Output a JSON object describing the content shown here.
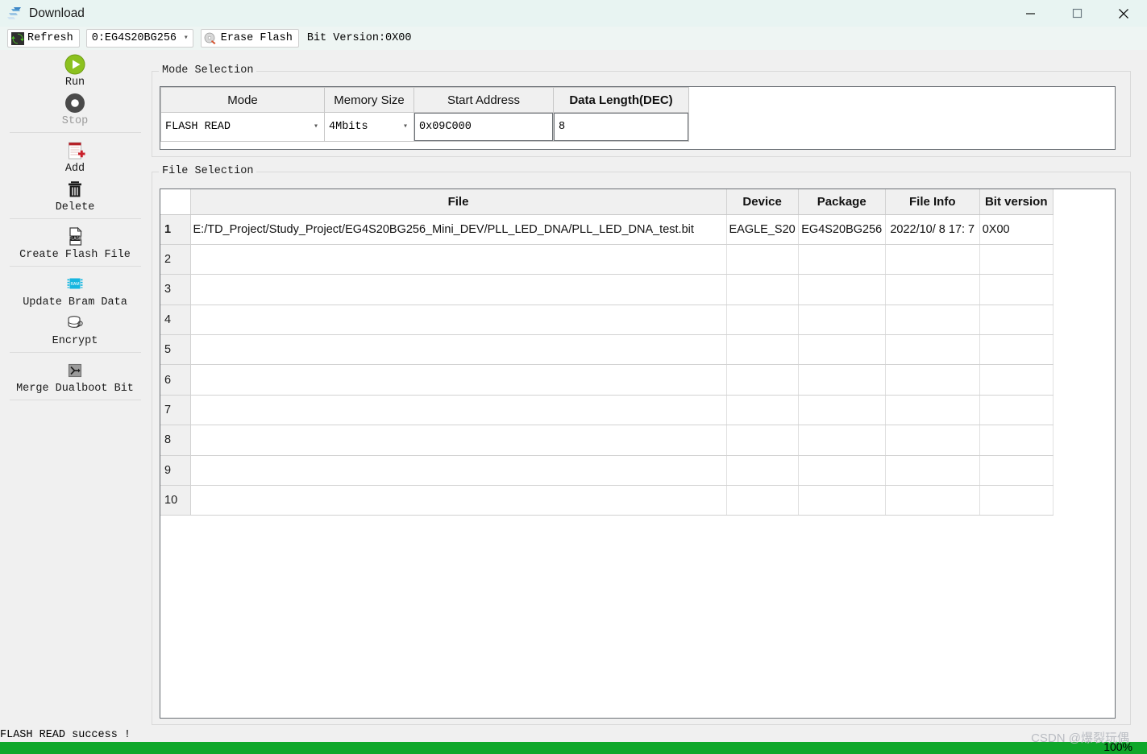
{
  "window": {
    "title": "Download",
    "icon": "app-logo-icon",
    "controls": {
      "minimize": "minimize-icon",
      "maximize": "maximize-icon",
      "close": "close-icon"
    }
  },
  "toolbar": {
    "refresh_label": "Refresh",
    "refresh_icon": "refresh-icon",
    "device_combo_value": "0:EG4S20BG256",
    "erase_label": "Erase Flash",
    "erase_icon": "disc-erase-icon",
    "bit_version_label": "Bit Version:0X00"
  },
  "sidebar": {
    "items": [
      {
        "label": "Run",
        "icon": "play-icon",
        "enabled": true
      },
      {
        "label": "Stop",
        "icon": "stop-icon",
        "enabled": false
      },
      {
        "label": "Add",
        "icon": "add-file-icon",
        "enabled": true
      },
      {
        "label": "Delete",
        "icon": "trash-icon",
        "enabled": true
      },
      {
        "label": "Create Flash File",
        "icon": "flash-file-icon",
        "enabled": true
      },
      {
        "label": "Update Bram Data",
        "icon": "ram-chip-icon",
        "enabled": true
      },
      {
        "label": "Encrypt",
        "icon": "database-key-icon",
        "enabled": true
      },
      {
        "label": "Merge Dualboot Bit",
        "icon": "merge-icon",
        "enabled": true
      }
    ]
  },
  "mode_selection": {
    "title": "Mode Selection",
    "headers": [
      "Mode",
      "Memory Size",
      "Start Address",
      "Data Length(DEC)"
    ],
    "values": {
      "mode": "FLASH READ",
      "memory_size": "4Mbits",
      "start_address": "0x09C000",
      "data_length": "8"
    }
  },
  "file_selection": {
    "title": "File Selection",
    "headers": [
      "",
      "File",
      "Device",
      "Package",
      "File Info",
      "Bit version"
    ],
    "rows": [
      {
        "num": "1",
        "file": "E:/TD_Project/Study_Project/EG4S20BG256_Mini_DEV/PLL_LED_DNA/PLL_LED_DNA_test.bit",
        "device": "EAGLE_S20",
        "package": "EG4S20BG256",
        "file_info": "2022/10/ 8 17: 7",
        "bit_version": "0X00"
      },
      {
        "num": "2",
        "file": "",
        "device": "",
        "package": "",
        "file_info": "",
        "bit_version": ""
      },
      {
        "num": "3",
        "file": "",
        "device": "",
        "package": "",
        "file_info": "",
        "bit_version": ""
      },
      {
        "num": "4",
        "file": "",
        "device": "",
        "package": "",
        "file_info": "",
        "bit_version": ""
      },
      {
        "num": "5",
        "file": "",
        "device": "",
        "package": "",
        "file_info": "",
        "bit_version": ""
      },
      {
        "num": "6",
        "file": "",
        "device": "",
        "package": "",
        "file_info": "",
        "bit_version": ""
      },
      {
        "num": "7",
        "file": "",
        "device": "",
        "package": "",
        "file_info": "",
        "bit_version": ""
      },
      {
        "num": "8",
        "file": "",
        "device": "",
        "package": "",
        "file_info": "",
        "bit_version": ""
      },
      {
        "num": "9",
        "file": "",
        "device": "",
        "package": "",
        "file_info": "",
        "bit_version": ""
      },
      {
        "num": "10",
        "file": "",
        "device": "",
        "package": "",
        "file_info": "",
        "bit_version": ""
      }
    ]
  },
  "status": {
    "message": "FLASH READ success !",
    "progress_percent": "100%",
    "progress_value": 100,
    "progress_color": "#0fa72a",
    "watermark": "CSDN @爆裂玩偶"
  }
}
